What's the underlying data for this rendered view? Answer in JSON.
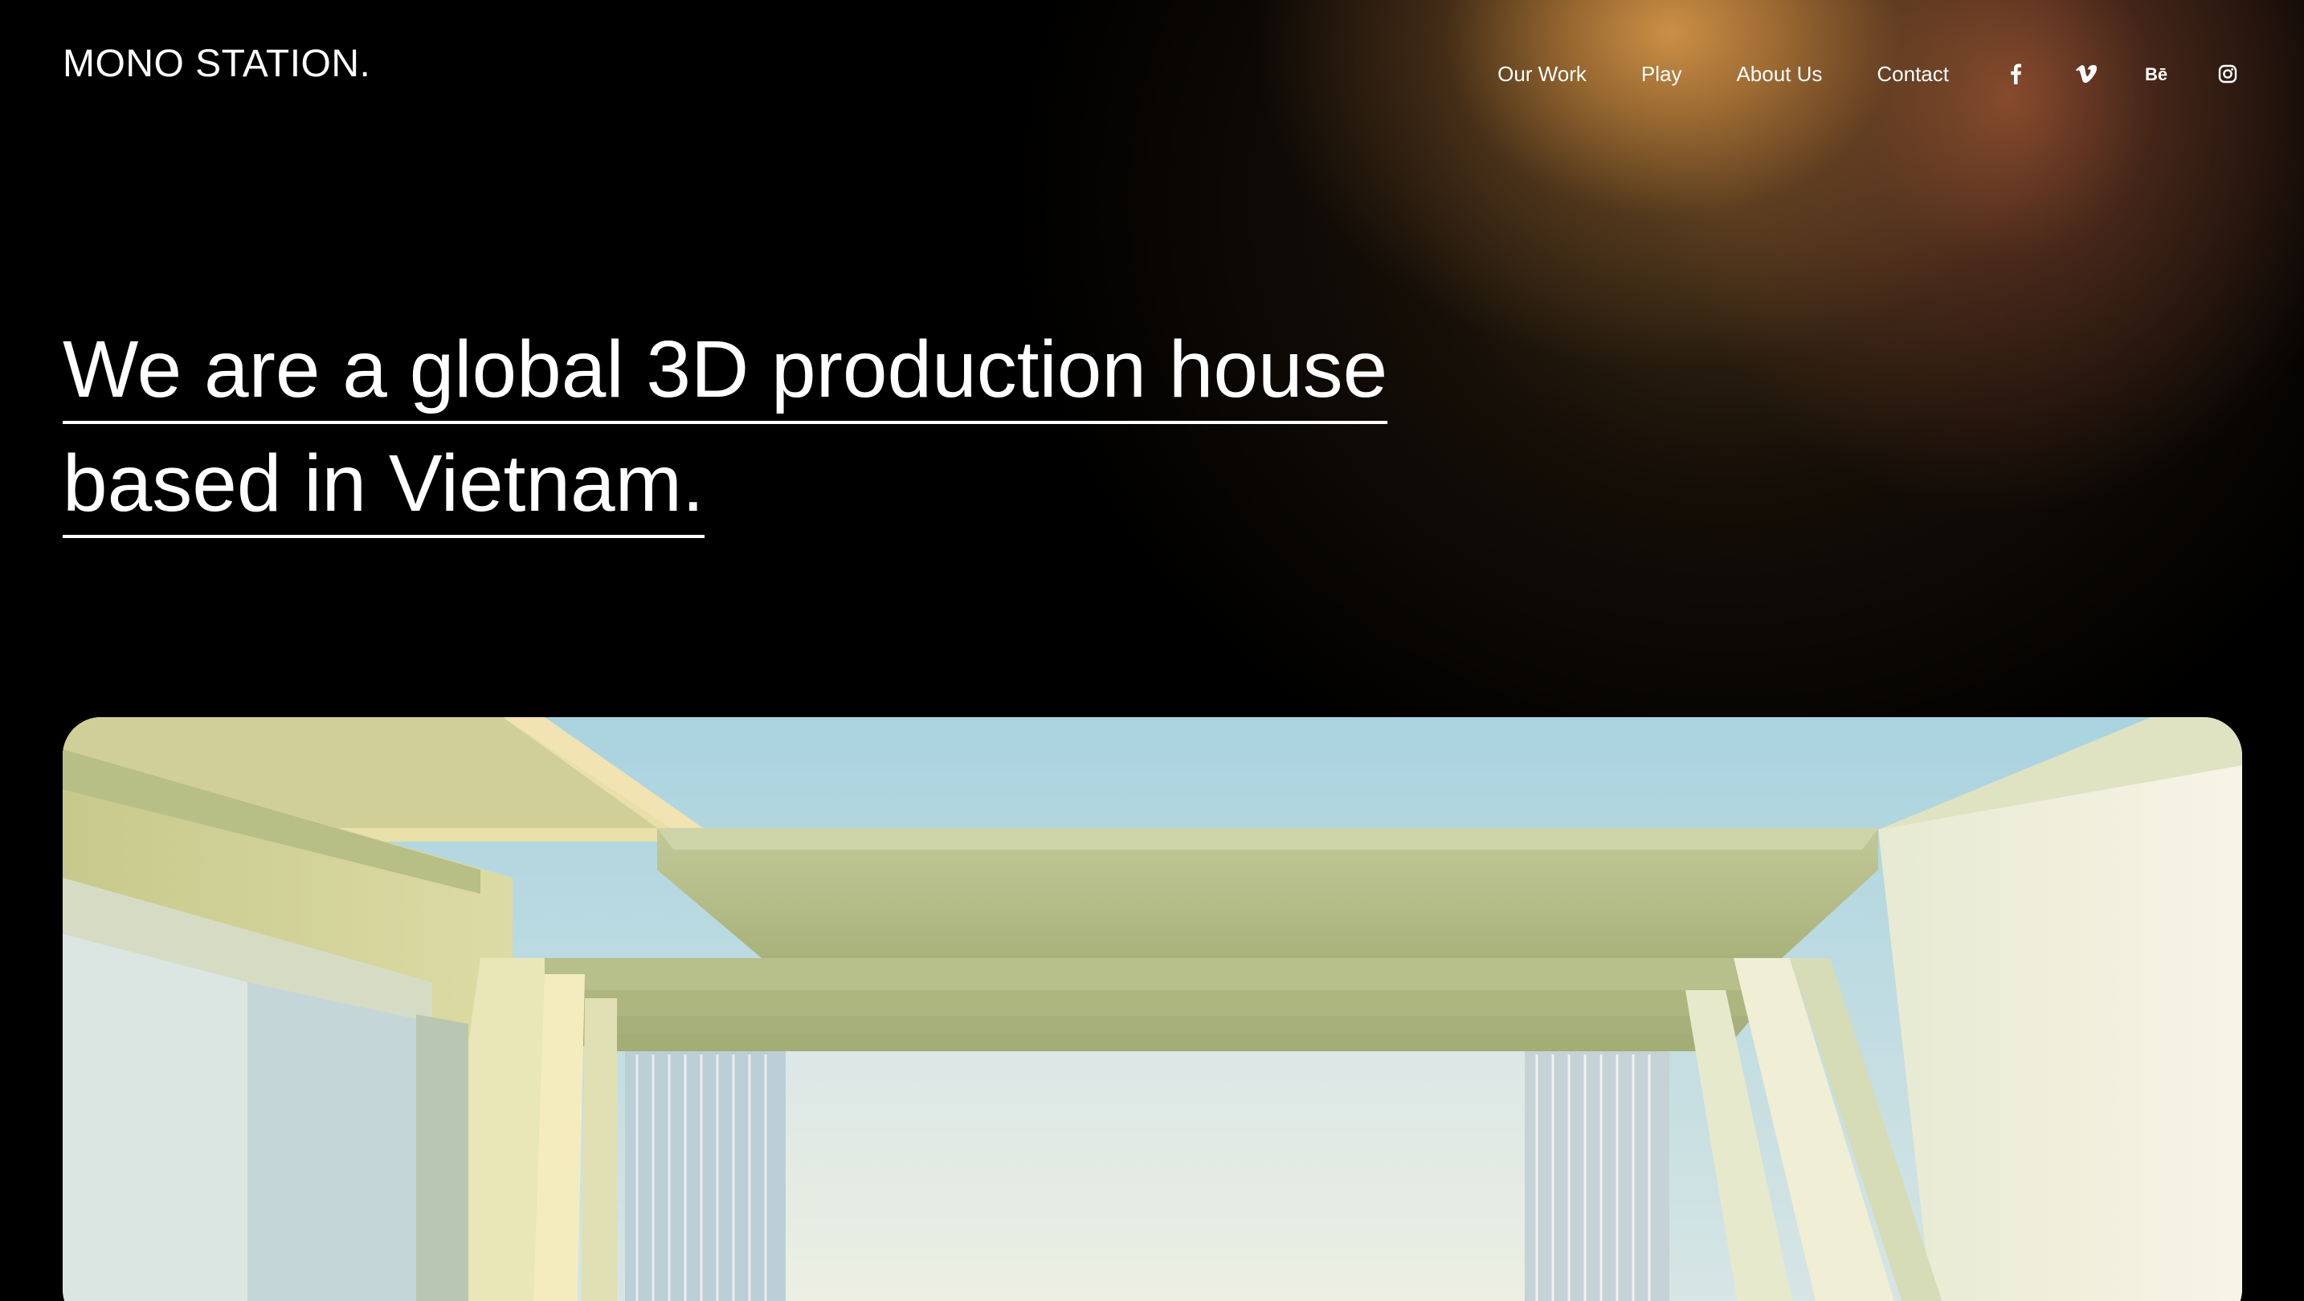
{
  "brand": {
    "logo_text": "MONO STATION."
  },
  "nav": {
    "items": [
      {
        "label": "Our Work"
      },
      {
        "label": "Play"
      },
      {
        "label": "About Us"
      },
      {
        "label": "Contact"
      }
    ],
    "social": [
      {
        "icon": "facebook-icon"
      },
      {
        "icon": "vimeo-icon"
      },
      {
        "icon": "behance-icon"
      },
      {
        "icon": "instagram-icon"
      }
    ]
  },
  "hero": {
    "line1": "We are a global 3D production house",
    "line2": "based in Vietnam."
  },
  "colors": {
    "background": "#000000",
    "text": "#ffffff",
    "glow_gold": "#d5964a",
    "glow_copper": "#96503a"
  }
}
